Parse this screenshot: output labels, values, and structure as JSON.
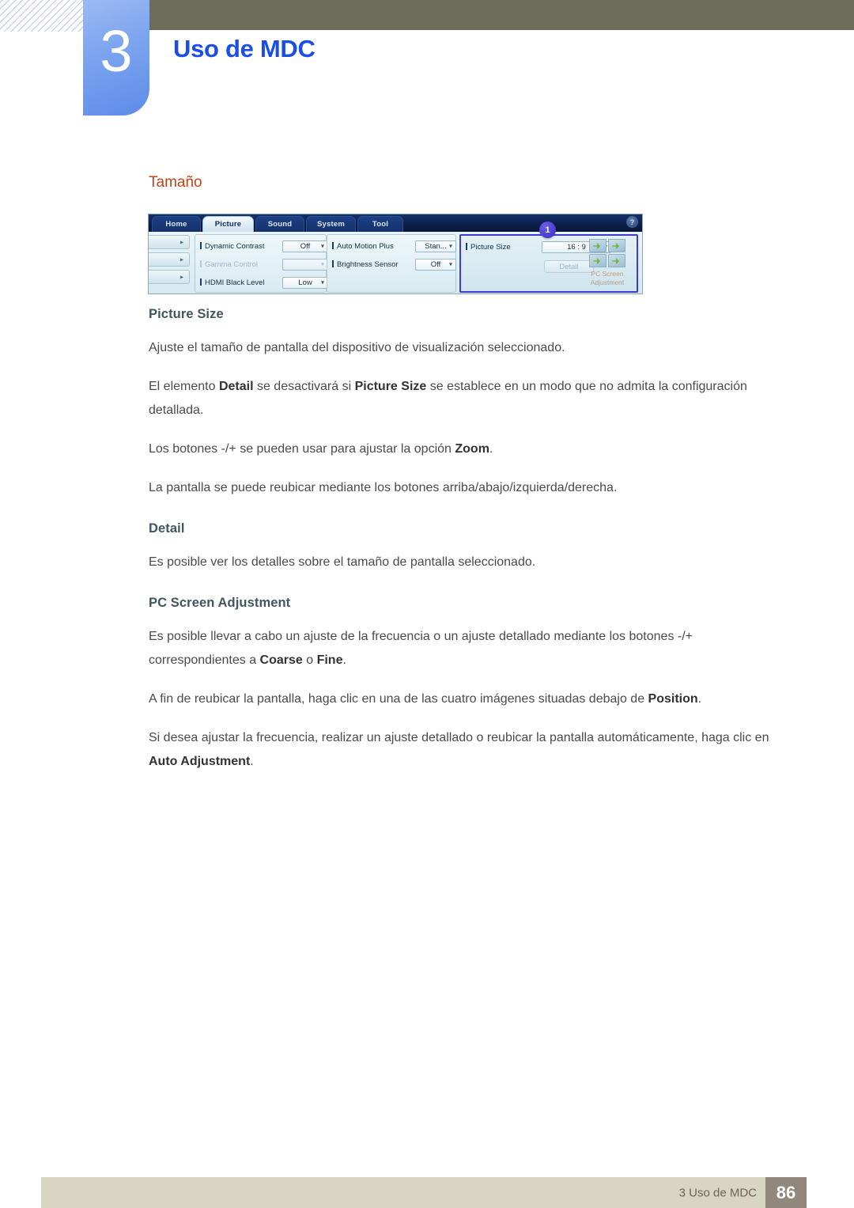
{
  "header": {
    "chapter_number": "3",
    "chapter_title": "Uso de MDC",
    "accent_blue": "#1b4ee8",
    "tab_gradient_from": "#9cb9f3",
    "tab_gradient_to": "#5d8ce8",
    "topbar_color": "#6e6d59"
  },
  "section": {
    "title": "Tamaño",
    "title_color": "#c14417"
  },
  "mdc_ui": {
    "tabs": [
      {
        "label": "Home",
        "active": false
      },
      {
        "label": "Picture",
        "active": true
      },
      {
        "label": "Sound",
        "active": false
      },
      {
        "label": "System",
        "active": false
      },
      {
        "label": "Tool",
        "active": false
      }
    ],
    "help_label": "?",
    "group1": [
      {
        "label": "Dynamic Contrast",
        "value": "Off",
        "disabled": false
      },
      {
        "label": "Gamma Control",
        "value": "",
        "disabled": true
      },
      {
        "label": "HDMI Black Level",
        "value": "Low",
        "disabled": false
      }
    ],
    "group2": [
      {
        "label": "Auto Motion Plus",
        "value": "Stan...",
        "disabled": false
      },
      {
        "label": "Brightness Sensor",
        "value": "Off",
        "disabled": false
      }
    ],
    "group3": {
      "picture_size_label": "Picture Size",
      "picture_size_value": "16 : 9",
      "detail_button": "Detail",
      "pc_screen_adjustment_label": "PC Screen Adjustment",
      "highlight_color": "#3b3bd6"
    },
    "callout": {
      "number": "1",
      "color": "#4a35d0"
    }
  },
  "body": {
    "h_picture_size": "Picture Size",
    "p1": "Ajuste el tamaño de pantalla del dispositivo de visualización seleccionado.",
    "p2_a": "El elemento ",
    "p2_b": "Detail",
    "p2_c": " se desactivará si ",
    "p2_d": "Picture Size",
    "p2_e": " se establece en un modo que no admita la configuración detallada.",
    "p3_a": "Los botones -/+ se pueden usar para ajustar la opción ",
    "p3_b": "Zoom",
    "p3_c": ".",
    "p4": "La pantalla se puede reubicar mediante los botones arriba/abajo/izquierda/derecha.",
    "h_detail": "Detail",
    "p5": "Es posible ver los detalles sobre el tamaño de pantalla seleccionado.",
    "h_pc_screen": "PC Screen Adjustment",
    "p6_a": "Es posible llevar a cabo un ajuste de la frecuencia o un ajuste detallado mediante los botones -/+ correspondientes a ",
    "p6_b": "Coarse",
    "p6_c": " o ",
    "p6_d": "Fine",
    "p6_e": ".",
    "p7_a": "A fin de reubicar la pantalla, haga clic en una de las cuatro imágenes situadas debajo de ",
    "p7_b": "Position",
    "p7_c": ".",
    "p8_a": "Si desea ajustar la frecuencia, realizar un ajuste detallado o reubicar la pantalla automáticamente, haga clic en ",
    "p8_b": "Auto Adjustment",
    "p8_c": "."
  },
  "footer": {
    "text": "3 Uso de MDC",
    "page_number": "86",
    "bar_color": "#d9d5c3",
    "page_box_color": "#92877b"
  }
}
